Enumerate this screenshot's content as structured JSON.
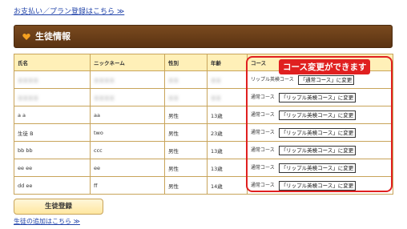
{
  "top_link": "お支払い／プラン登録はこちら ≫",
  "section": {
    "title": "生徒情報",
    "icon": "heart-icon"
  },
  "table": {
    "headers": [
      "氏名",
      "ニックネーム",
      "性別",
      "年齢",
      "コース"
    ],
    "rows": [
      {
        "name": "ＸＸＸＸ",
        "nickname": "ＸＸＸＸ",
        "gender": "ＸＸ",
        "age": "ＸＸ",
        "course": "リップル英検コース",
        "button": "「通常コース」に変更"
      },
      {
        "name": "ＸＸＸＸ",
        "nickname": "ＸＸＸＸ",
        "gender": "ＸＸ",
        "age": "ＸＸ",
        "course": "通常コース",
        "button": "「リップル英検コース」に変更"
      },
      {
        "name": "a a",
        "nickname": "aa",
        "gender": "男性",
        "age": "13歳",
        "course": "通常コース",
        "button": "「リップル英検コース」に変更"
      },
      {
        "name": "生徒 B",
        "nickname": "two",
        "gender": "男性",
        "age": "23歳",
        "course": "通常コース",
        "button": "「リップル英検コース」に変更"
      },
      {
        "name": "bb bb",
        "nickname": "ccc",
        "gender": "男性",
        "age": "13歳",
        "course": "通常コース",
        "button": "「リップル英検コース」に変更"
      },
      {
        "name": "ee ee",
        "nickname": "ee",
        "gender": "男性",
        "age": "13歳",
        "course": "通常コース",
        "button": "「リップル英検コース」に変更"
      },
      {
        "name": "dd ee",
        "nickname": "ff",
        "gender": "男性",
        "age": "14歳",
        "course": "通常コース",
        "button": "「リップル英検コース」に変更"
      }
    ]
  },
  "callout": "コース変更ができます",
  "register_button": "生徒登録",
  "bottom_link": "生徒の追加はこちら ≫",
  "colors": {
    "header_bar": "#6b3d18",
    "table_header": "#fff0b8",
    "table_border": "#c8a45a",
    "callout": "#e02020",
    "link": "#2244aa"
  }
}
